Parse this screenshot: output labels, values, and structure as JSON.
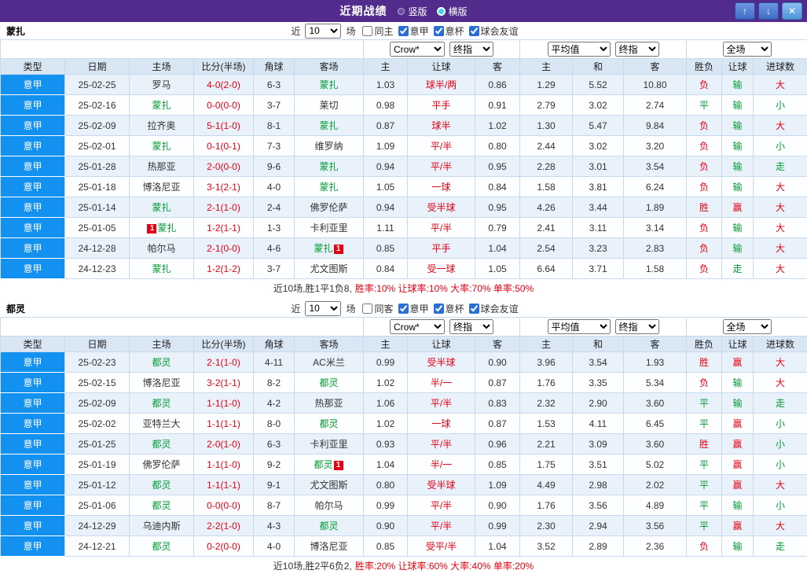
{
  "titlebar": {
    "title": "近期战绩",
    "view_options": [
      {
        "label": "竖版",
        "selected": false
      },
      {
        "label": "横版",
        "selected": true
      }
    ],
    "buttons": {
      "up": "↑",
      "down": "↓",
      "close": "✕"
    }
  },
  "colors": {
    "titlebar_purple": "#512c8c",
    "league_blue": "#1391f0",
    "header_bg": "#d9e6f3",
    "row_alt_bg": "#e9f2fb",
    "accent_red": "#e60012",
    "accent_green": "#019a31"
  },
  "sections": [
    {
      "team": "蒙扎",
      "filter": {
        "near_label": "近",
        "count_value": "10",
        "games_label": "场",
        "checkboxes": [
          {
            "label": "同主",
            "checked": false
          },
          {
            "label": "意甲",
            "checked": true
          },
          {
            "label": "意杯",
            "checked": true
          },
          {
            "label": "球会友谊",
            "checked": true
          }
        ]
      },
      "selects": {
        "company": "Crow*",
        "company_mode": "终指",
        "average": "平均值",
        "average_mode": "终指",
        "scope": "全场"
      },
      "columns": [
        "类型",
        "日期",
        "主场",
        "比分(半场)",
        "角球",
        "客场",
        "主",
        "让球",
        "客",
        "主",
        "和",
        "客",
        "胜负",
        "让球",
        "进球数"
      ],
      "rows": [
        {
          "league": "意甲",
          "date": "25-02-25",
          "home": "罗马",
          "home_self": false,
          "home_badge": null,
          "score": "4-0(2-0)",
          "corner": "6-3",
          "away": "蒙扎",
          "away_self": true,
          "away_badge": null,
          "odds": [
            "1.03",
            "球半/两",
            "0.86"
          ],
          "avg": [
            "1.29",
            "5.52",
            "10.80"
          ],
          "result": {
            "t": "负",
            "c": "red"
          },
          "handicap_result": {
            "t": "输",
            "c": "green"
          },
          "goal_result": {
            "t": "大",
            "c": "red"
          }
        },
        {
          "league": "意甲",
          "date": "25-02-16",
          "home": "蒙扎",
          "home_self": true,
          "home_badge": null,
          "score": "0-0(0-0)",
          "corner": "3-7",
          "away": "莱切",
          "away_self": false,
          "away_badge": null,
          "odds": [
            "0.98",
            "平手",
            "0.91"
          ],
          "avg": [
            "2.79",
            "3.02",
            "2.74"
          ],
          "result": {
            "t": "平",
            "c": "green"
          },
          "handicap_result": {
            "t": "输",
            "c": "green"
          },
          "goal_result": {
            "t": "小",
            "c": "green"
          }
        },
        {
          "league": "意甲",
          "date": "25-02-09",
          "home": "拉齐奥",
          "home_self": false,
          "home_badge": null,
          "score": "5-1(1-0)",
          "corner": "8-1",
          "away": "蒙扎",
          "away_self": true,
          "away_badge": null,
          "odds": [
            "0.87",
            "球半",
            "1.02"
          ],
          "avg": [
            "1.30",
            "5.47",
            "9.84"
          ],
          "result": {
            "t": "负",
            "c": "red"
          },
          "handicap_result": {
            "t": "输",
            "c": "green"
          },
          "goal_result": {
            "t": "大",
            "c": "red"
          }
        },
        {
          "league": "意甲",
          "date": "25-02-01",
          "home": "蒙扎",
          "home_self": true,
          "home_badge": null,
          "score": "0-1(0-1)",
          "corner": "7-3",
          "away": "维罗纳",
          "away_self": false,
          "away_badge": null,
          "odds": [
            "1.09",
            "平/半",
            "0.80"
          ],
          "avg": [
            "2.44",
            "3.02",
            "3.20"
          ],
          "result": {
            "t": "负",
            "c": "red"
          },
          "handicap_result": {
            "t": "输",
            "c": "green"
          },
          "goal_result": {
            "t": "小",
            "c": "green"
          }
        },
        {
          "league": "意甲",
          "date": "25-01-28",
          "home": "热那亚",
          "home_self": false,
          "home_badge": null,
          "score": "2-0(0-0)",
          "corner": "9-6",
          "away": "蒙扎",
          "away_self": true,
          "away_badge": null,
          "odds": [
            "0.94",
            "平/半",
            "0.95"
          ],
          "avg": [
            "2.28",
            "3.01",
            "3.54"
          ],
          "result": {
            "t": "负",
            "c": "red"
          },
          "handicap_result": {
            "t": "输",
            "c": "green"
          },
          "goal_result": {
            "t": "走",
            "c": "green"
          }
        },
        {
          "league": "意甲",
          "date": "25-01-18",
          "home": "博洛尼亚",
          "home_self": false,
          "home_badge": null,
          "score": "3-1(2-1)",
          "corner": "4-0",
          "away": "蒙扎",
          "away_self": true,
          "away_badge": null,
          "odds": [
            "1.05",
            "一球",
            "0.84"
          ],
          "avg": [
            "1.58",
            "3.81",
            "6.24"
          ],
          "result": {
            "t": "负",
            "c": "red"
          },
          "handicap_result": {
            "t": "输",
            "c": "green"
          },
          "goal_result": {
            "t": "大",
            "c": "red"
          }
        },
        {
          "league": "意甲",
          "date": "25-01-14",
          "home": "蒙扎",
          "home_self": true,
          "home_badge": null,
          "score": "2-1(1-0)",
          "corner": "2-4",
          "away": "佛罗伦萨",
          "away_self": false,
          "away_badge": null,
          "odds": [
            "0.94",
            "受半球",
            "0.95"
          ],
          "avg": [
            "4.26",
            "3.44",
            "1.89"
          ],
          "result": {
            "t": "胜",
            "c": "red"
          },
          "handicap_result": {
            "t": "赢",
            "c": "red"
          },
          "goal_result": {
            "t": "大",
            "c": "red"
          }
        },
        {
          "league": "意甲",
          "date": "25-01-05",
          "home": "蒙扎",
          "home_self": true,
          "home_badge": {
            "text": "1",
            "pos": "before"
          },
          "score": "1-2(1-1)",
          "corner": "1-3",
          "away": "卡利亚里",
          "away_self": false,
          "away_badge": null,
          "odds": [
            "1.11",
            "平/半",
            "0.79"
          ],
          "avg": [
            "2.41",
            "3.11",
            "3.14"
          ],
          "result": {
            "t": "负",
            "c": "red"
          },
          "handicap_result": {
            "t": "输",
            "c": "green"
          },
          "goal_result": {
            "t": "大",
            "c": "red"
          }
        },
        {
          "league": "意甲",
          "date": "24-12-28",
          "home": "帕尔马",
          "home_self": false,
          "home_badge": null,
          "score": "2-1(0-0)",
          "corner": "4-6",
          "away": "蒙扎",
          "away_self": true,
          "away_badge": {
            "text": "1",
            "pos": "after"
          },
          "odds": [
            "0.85",
            "平手",
            "1.04"
          ],
          "avg": [
            "2.54",
            "3.23",
            "2.83"
          ],
          "result": {
            "t": "负",
            "c": "red"
          },
          "handicap_result": {
            "t": "输",
            "c": "green"
          },
          "goal_result": {
            "t": "大",
            "c": "red"
          }
        },
        {
          "league": "意甲",
          "date": "24-12-23",
          "home": "蒙扎",
          "home_self": true,
          "home_badge": null,
          "score": "1-2(1-2)",
          "corner": "3-7",
          "away": "尤文图斯",
          "away_self": false,
          "away_badge": null,
          "odds": [
            "0.84",
            "受一球",
            "1.05"
          ],
          "avg": [
            "6.64",
            "3.71",
            "1.58"
          ],
          "result": {
            "t": "负",
            "c": "red"
          },
          "handicap_result": {
            "t": "走",
            "c": "green"
          },
          "goal_result": {
            "t": "大",
            "c": "red"
          }
        }
      ],
      "summary_black": "近10场,胜1平1负8,",
      "summary_red": "胜率:10% 让球率:10% 大率:70% 单率:50%"
    },
    {
      "team": "都灵",
      "filter": {
        "near_label": "近",
        "count_value": "10",
        "games_label": "场",
        "checkboxes": [
          {
            "label": "同客",
            "checked": false
          },
          {
            "label": "意甲",
            "checked": true
          },
          {
            "label": "意杯",
            "checked": true
          },
          {
            "label": "球会友谊",
            "checked": true
          }
        ]
      },
      "selects": {
        "company": "Crow*",
        "company_mode": "终指",
        "average": "平均值",
        "average_mode": "终指",
        "scope": "全场"
      },
      "columns": [
        "类型",
        "日期",
        "主场",
        "比分(半场)",
        "角球",
        "客场",
        "主",
        "让球",
        "客",
        "主",
        "和",
        "客",
        "胜负",
        "让球",
        "进球数"
      ],
      "rows": [
        {
          "league": "意甲",
          "date": "25-02-23",
          "home": "都灵",
          "home_self": true,
          "home_badge": null,
          "score": "2-1(1-0)",
          "corner": "4-11",
          "away": "AC米兰",
          "away_self": false,
          "away_badge": null,
          "odds": [
            "0.99",
            "受半球",
            "0.90"
          ],
          "avg": [
            "3.96",
            "3.54",
            "1.93"
          ],
          "result": {
            "t": "胜",
            "c": "red"
          },
          "handicap_result": {
            "t": "赢",
            "c": "red"
          },
          "goal_result": {
            "t": "大",
            "c": "red"
          }
        },
        {
          "league": "意甲",
          "date": "25-02-15",
          "home": "博洛尼亚",
          "home_self": false,
          "home_badge": null,
          "score": "3-2(1-1)",
          "corner": "8-2",
          "away": "都灵",
          "away_self": true,
          "away_badge": null,
          "odds": [
            "1.02",
            "半/一",
            "0.87"
          ],
          "avg": [
            "1.76",
            "3.35",
            "5.34"
          ],
          "result": {
            "t": "负",
            "c": "red"
          },
          "handicap_result": {
            "t": "输",
            "c": "green"
          },
          "goal_result": {
            "t": "大",
            "c": "red"
          }
        },
        {
          "league": "意甲",
          "date": "25-02-09",
          "home": "都灵",
          "home_self": true,
          "home_badge": null,
          "score": "1-1(1-0)",
          "corner": "4-2",
          "away": "热那亚",
          "away_self": false,
          "away_badge": null,
          "odds": [
            "1.06",
            "平/半",
            "0.83"
          ],
          "avg": [
            "2.32",
            "2.90",
            "3.60"
          ],
          "result": {
            "t": "平",
            "c": "green"
          },
          "handicap_result": {
            "t": "输",
            "c": "green"
          },
          "goal_result": {
            "t": "走",
            "c": "green"
          }
        },
        {
          "league": "意甲",
          "date": "25-02-02",
          "home": "亚特兰大",
          "home_self": false,
          "home_badge": null,
          "score": "1-1(1-1)",
          "corner": "8-0",
          "away": "都灵",
          "away_self": true,
          "away_badge": null,
          "odds": [
            "1.02",
            "一球",
            "0.87"
          ],
          "avg": [
            "1.53",
            "4.11",
            "6.45"
          ],
          "result": {
            "t": "平",
            "c": "green"
          },
          "handicap_result": {
            "t": "赢",
            "c": "red"
          },
          "goal_result": {
            "t": "小",
            "c": "green"
          }
        },
        {
          "league": "意甲",
          "date": "25-01-25",
          "home": "都灵",
          "home_self": true,
          "home_badge": null,
          "score": "2-0(1-0)",
          "corner": "6-3",
          "away": "卡利亚里",
          "away_self": false,
          "away_badge": null,
          "odds": [
            "0.93",
            "平/半",
            "0.96"
          ],
          "avg": [
            "2.21",
            "3.09",
            "3.60"
          ],
          "result": {
            "t": "胜",
            "c": "red"
          },
          "handicap_result": {
            "t": "赢",
            "c": "red"
          },
          "goal_result": {
            "t": "小",
            "c": "green"
          }
        },
        {
          "league": "意甲",
          "date": "25-01-19",
          "home": "佛罗伦萨",
          "home_self": false,
          "home_badge": null,
          "score": "1-1(1-0)",
          "corner": "9-2",
          "away": "都灵",
          "away_self": true,
          "away_badge": {
            "text": "1",
            "pos": "after"
          },
          "odds": [
            "1.04",
            "半/一",
            "0.85"
          ],
          "avg": [
            "1.75",
            "3.51",
            "5.02"
          ],
          "result": {
            "t": "平",
            "c": "green"
          },
          "handicap_result": {
            "t": "赢",
            "c": "red"
          },
          "goal_result": {
            "t": "小",
            "c": "green"
          }
        },
        {
          "league": "意甲",
          "date": "25-01-12",
          "home": "都灵",
          "home_self": true,
          "home_badge": null,
          "score": "1-1(1-1)",
          "corner": "9-1",
          "away": "尤文图斯",
          "away_self": false,
          "away_badge": null,
          "odds": [
            "0.80",
            "受半球",
            "1.09"
          ],
          "avg": [
            "4.49",
            "2.98",
            "2.02"
          ],
          "result": {
            "t": "平",
            "c": "green"
          },
          "handicap_result": {
            "t": "赢",
            "c": "red"
          },
          "goal_result": {
            "t": "大",
            "c": "red"
          }
        },
        {
          "league": "意甲",
          "date": "25-01-06",
          "home": "都灵",
          "home_self": true,
          "home_badge": null,
          "score": "0-0(0-0)",
          "corner": "8-7",
          "away": "帕尔马",
          "away_self": false,
          "away_badge": null,
          "odds": [
            "0.99",
            "平/半",
            "0.90"
          ],
          "avg": [
            "1.76",
            "3.56",
            "4.89"
          ],
          "result": {
            "t": "平",
            "c": "green"
          },
          "handicap_result": {
            "t": "输",
            "c": "green"
          },
          "goal_result": {
            "t": "小",
            "c": "green"
          }
        },
        {
          "league": "意甲",
          "date": "24-12-29",
          "home": "乌迪内斯",
          "home_self": false,
          "home_badge": null,
          "score": "2-2(1-0)",
          "corner": "4-3",
          "away": "都灵",
          "away_self": true,
          "away_badge": null,
          "odds": [
            "0.90",
            "平/半",
            "0.99"
          ],
          "avg": [
            "2.30",
            "2.94",
            "3.56"
          ],
          "result": {
            "t": "平",
            "c": "green"
          },
          "handicap_result": {
            "t": "赢",
            "c": "red"
          },
          "goal_result": {
            "t": "大",
            "c": "red"
          }
        },
        {
          "league": "意甲",
          "date": "24-12-21",
          "home": "都灵",
          "home_self": true,
          "home_badge": null,
          "score": "0-2(0-0)",
          "corner": "4-0",
          "away": "博洛尼亚",
          "away_self": false,
          "away_badge": null,
          "odds": [
            "0.85",
            "受平/半",
            "1.04"
          ],
          "avg": [
            "3.52",
            "2.89",
            "2.36"
          ],
          "result": {
            "t": "负",
            "c": "red"
          },
          "handicap_result": {
            "t": "输",
            "c": "green"
          },
          "goal_result": {
            "t": "走",
            "c": "green"
          }
        }
      ],
      "summary_black": "近10场,胜2平6负2,",
      "summary_red": "胜率:20% 让球率:60% 大率:40% 单率:20%"
    }
  ]
}
